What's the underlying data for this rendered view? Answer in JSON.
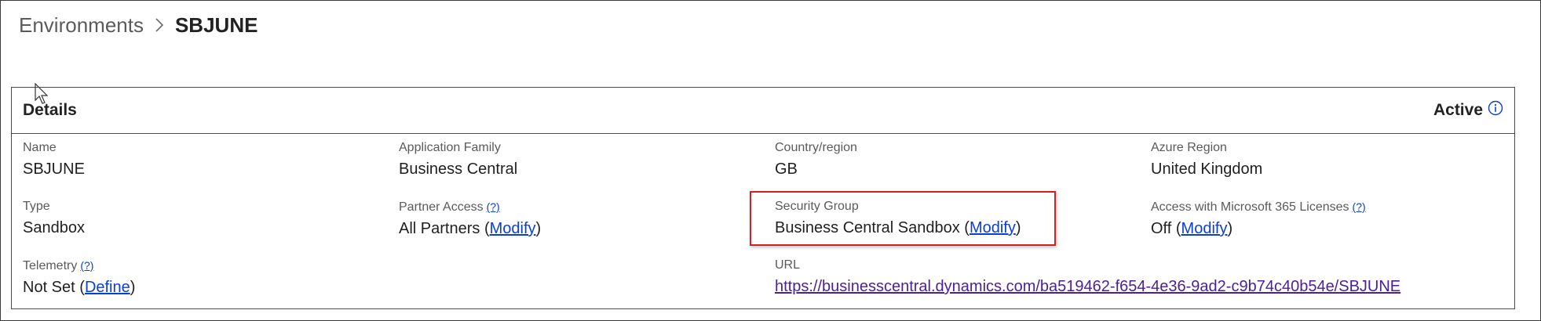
{
  "breadcrumb": {
    "parent": "Environments",
    "separator_icon": "chevron-right-icon",
    "current": "SBJUNE"
  },
  "details": {
    "title": "Details",
    "status": "Active",
    "status_icon": "info-icon",
    "fields": {
      "name": {
        "label": "Name",
        "value": "SBJUNE"
      },
      "application_family": {
        "label": "Application Family",
        "value": "Business Central"
      },
      "country_region": {
        "label": "Country/region",
        "value": "GB"
      },
      "azure_region": {
        "label": "Azure Region",
        "value": "United Kingdom"
      },
      "type": {
        "label": "Type",
        "value": "Sandbox"
      },
      "partner_access": {
        "label": "Partner Access",
        "help": "(?)",
        "value": "All Partners",
        "open": "(",
        "action": "Modify",
        "close": ")"
      },
      "security_group": {
        "label": "Security Group",
        "value": "Business Central Sandbox",
        "open": "(",
        "action": "Modify",
        "close": ")"
      },
      "m365_access": {
        "label": "Access with Microsoft 365 Licenses",
        "help": "(?)",
        "value": "Off",
        "open": "(",
        "action": "Modify",
        "close": ")"
      },
      "telemetry": {
        "label": "Telemetry",
        "help": "(?)",
        "value": "Not Set",
        "open": "(",
        "action": "Define",
        "close": ")"
      },
      "url": {
        "label": "URL",
        "value": "https://businesscentral.dynamics.com/ba519462-f654-4e36-9ad2-c9b74c40b54e/SBJUNE"
      }
    }
  },
  "colors": {
    "link": "#0a3fd6",
    "visited_link": "#4b1e9e",
    "highlight": "#d42020"
  }
}
